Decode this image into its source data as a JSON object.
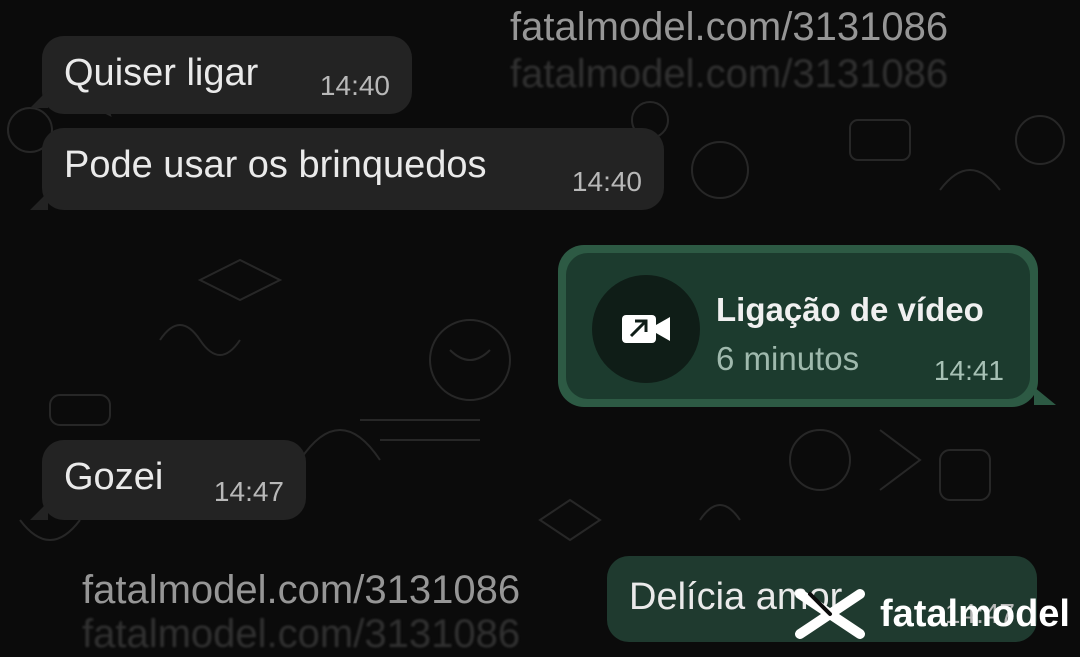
{
  "messages": [
    {
      "direction": "incoming",
      "text": "Quiser ligar",
      "time": "14:40"
    },
    {
      "direction": "incoming",
      "text": "Pode usar os brinquedos",
      "time": "14:40"
    },
    {
      "direction": "outgoing_call",
      "title": "Ligação de vídeo",
      "subtitle": "6 minutos",
      "time": "14:41",
      "icon": "video-call-icon"
    },
    {
      "direction": "incoming",
      "text": "Gozei",
      "time": "14:47"
    },
    {
      "direction": "outgoing",
      "text": "Delícia amor",
      "time": "14:47"
    }
  ],
  "watermarks": {
    "top": "fatalmodel.com/3131086",
    "bottom": "fatalmodel.com/3131086",
    "brand": "fatalmodel"
  },
  "colors": {
    "background": "#0b0b0b",
    "incoming_bubble": "#232323",
    "outgoing_bubble": "#1f3a2f",
    "call_card_border": "#2d5a44"
  }
}
